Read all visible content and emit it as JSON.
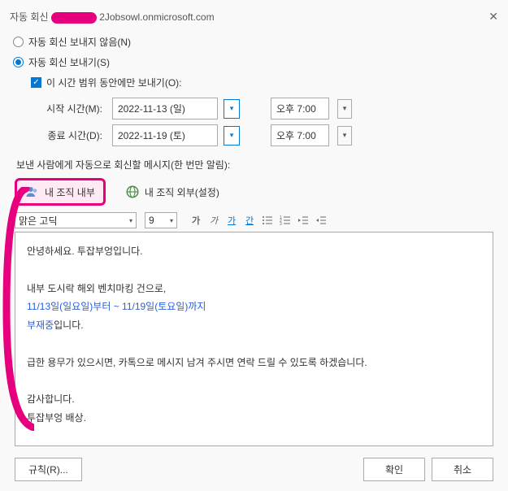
{
  "header": {
    "title_prefix": "자동 회신",
    "account_domain": "2Jobsowl.onmicrosoft.com"
  },
  "radios": {
    "dont_send": "자동 회신 보내지 않음(N)",
    "send": "자동 회신 보내기(S)"
  },
  "timerange": {
    "checkbox_label": "이 시간 범위 동안에만 보내기(O):",
    "start_label": "시작 시간(M):",
    "end_label": "종료 시간(D):",
    "start_date": "2022-11-13 (일)",
    "end_date": "2022-11-19 (토)",
    "start_time": "오후 7:00",
    "end_time": "오후 7:00"
  },
  "notice": "보낸 사람에게 자동으로 회신할 메시지(한 번만 알림):",
  "tabs": {
    "inside": "내 조직 내부",
    "outside": "내 조직 외부(설정)"
  },
  "toolbar": {
    "font_name": "맑은 고딕",
    "font_size": "9",
    "bold": "가",
    "italic": "가",
    "underline": "가",
    "color": "간"
  },
  "message": {
    "line1": "안녕하세요. 투잡부엉입니다.",
    "line2": "내부 도시락 해외 벤치마킹 건으로,",
    "line3": "11/13일(일요일)부터 ~ 11/19일(토요일)까지",
    "line4": "부재중",
    "line4_suffix": "입니다.",
    "line5": "급한 용무가 있으시면, 카톡으로 메시지 남겨 주시면 연락 드릴 수 있도록 하겠습니다.",
    "line6": "감사합니다.",
    "line7": "투잡부엉 배상."
  },
  "buttons": {
    "rules": "규칙(R)...",
    "ok": "확인",
    "cancel": "취소"
  }
}
